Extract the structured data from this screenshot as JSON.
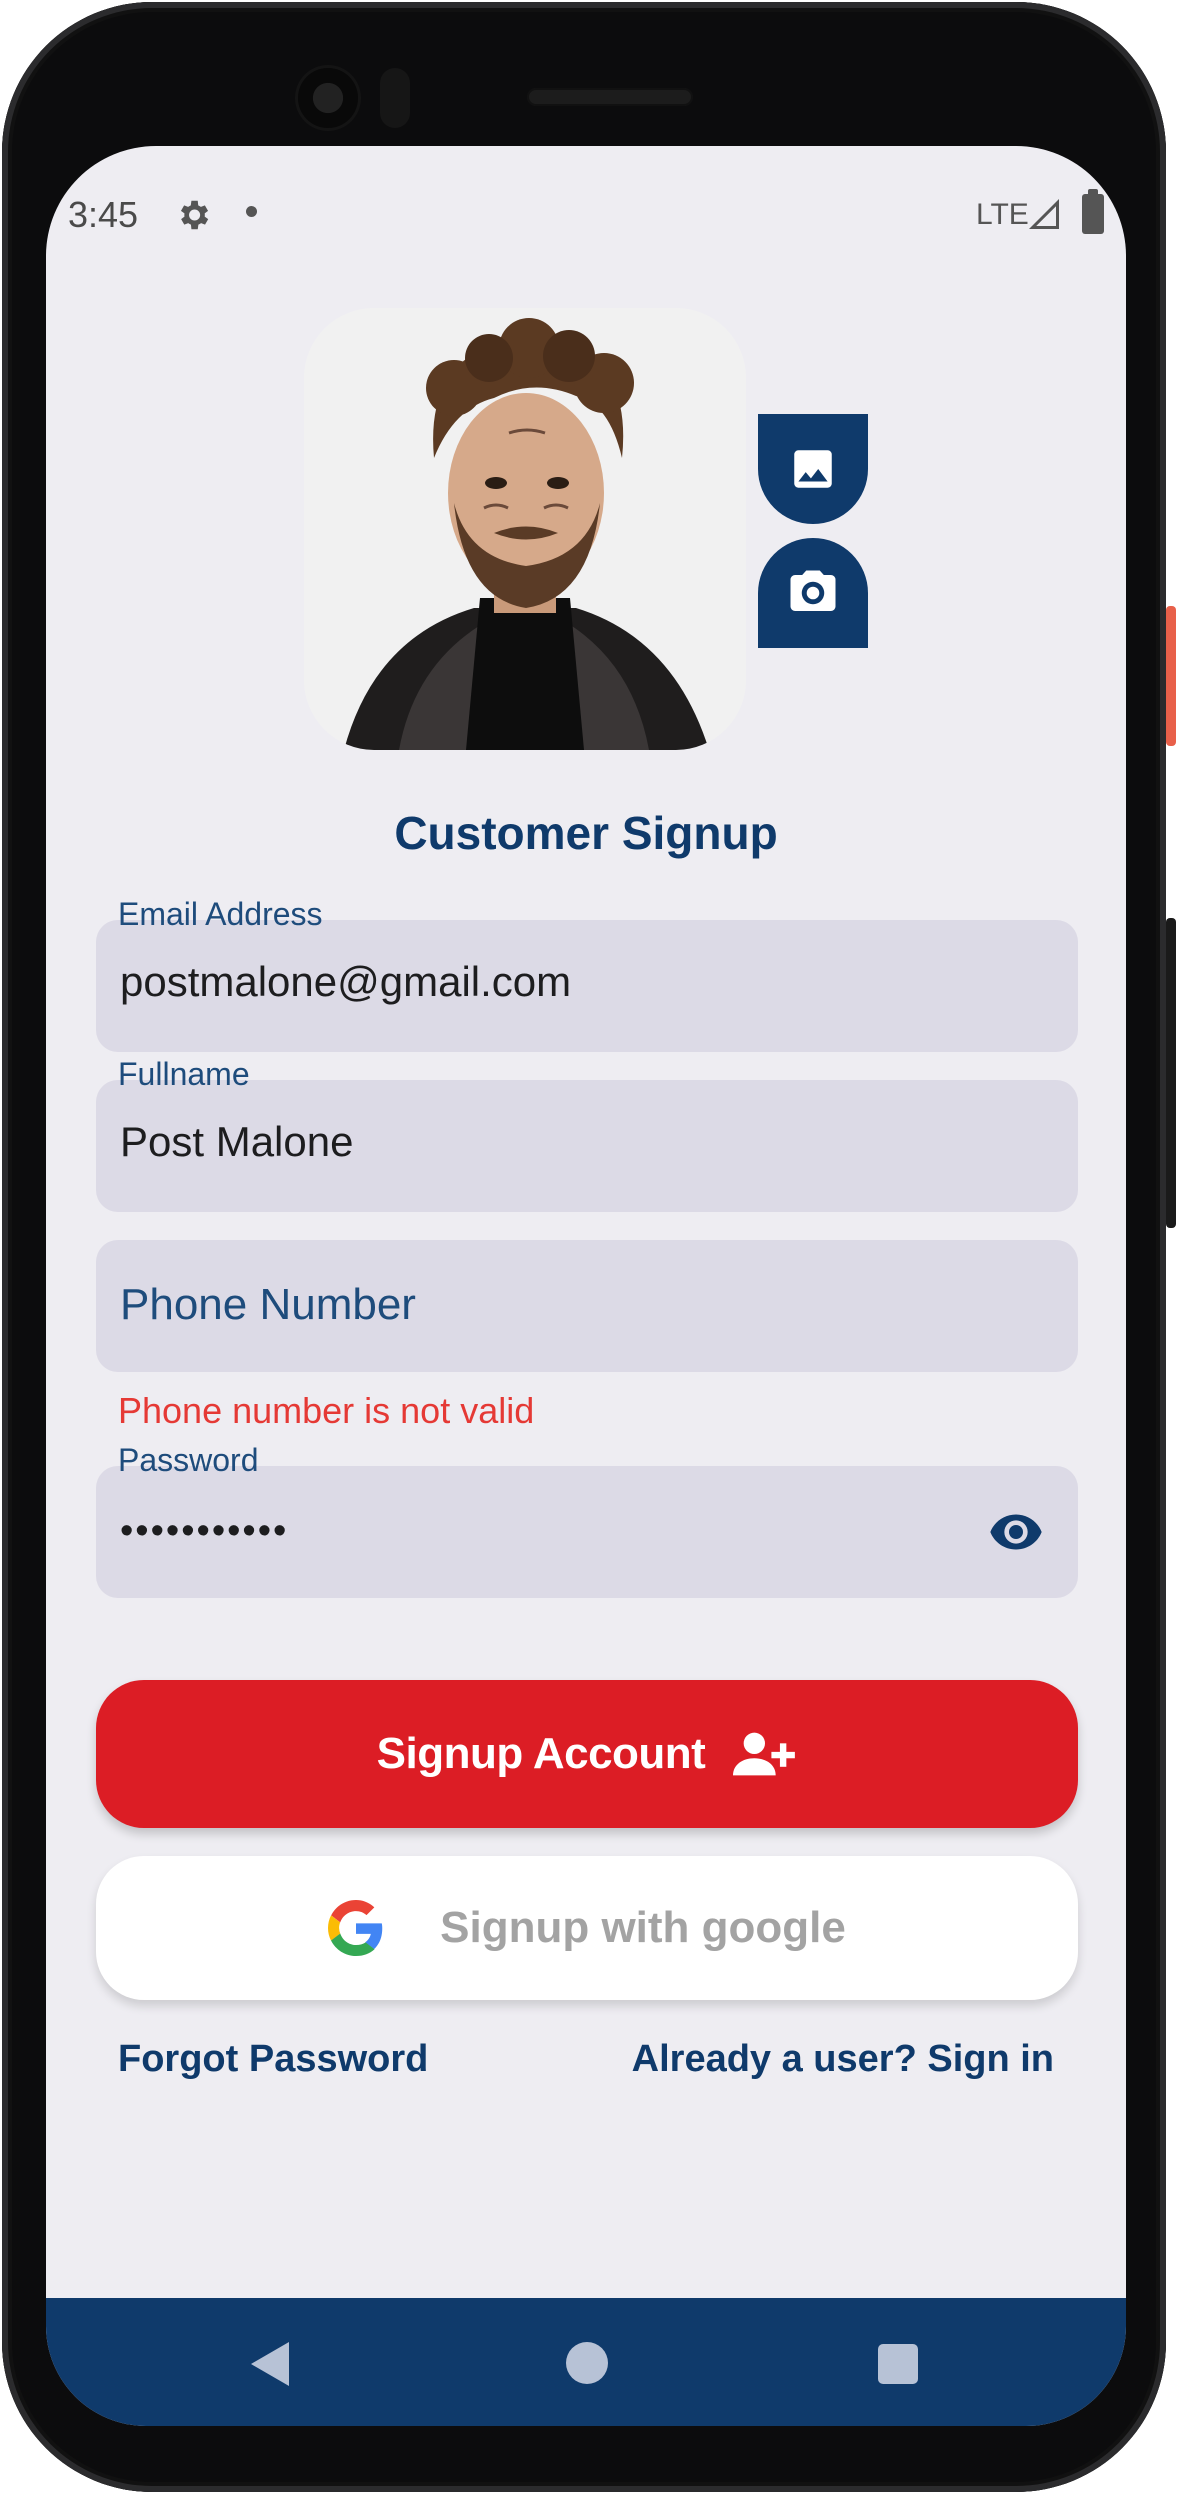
{
  "status_bar": {
    "time": "3:45",
    "network": "LTE"
  },
  "avatar": {
    "alt": "profile photo",
    "actions": [
      "gallery-icon",
      "camera-icon"
    ]
  },
  "page": {
    "title": "Customer Signup"
  },
  "form": {
    "email": {
      "label": "Email Address",
      "value": "postmalone@gmail.com"
    },
    "fullname": {
      "label": "Fullname",
      "value": "Post Malone"
    },
    "phone": {
      "placeholder": "Phone Number",
      "error": "Phone number is not valid"
    },
    "password": {
      "label": "Password",
      "value_masked": "•••••••••••"
    }
  },
  "buttons": {
    "signup": "Signup Account",
    "google": "Signup with google"
  },
  "links": {
    "forgot": "Forgot Password",
    "signin": "Already a user? Sign in"
  },
  "colors": {
    "primary": "#0f3a6b",
    "accent_red": "#dc1d25",
    "error": "#e53935",
    "field_bg": "#dcdae6",
    "screen_bg": "#eeedf2"
  }
}
